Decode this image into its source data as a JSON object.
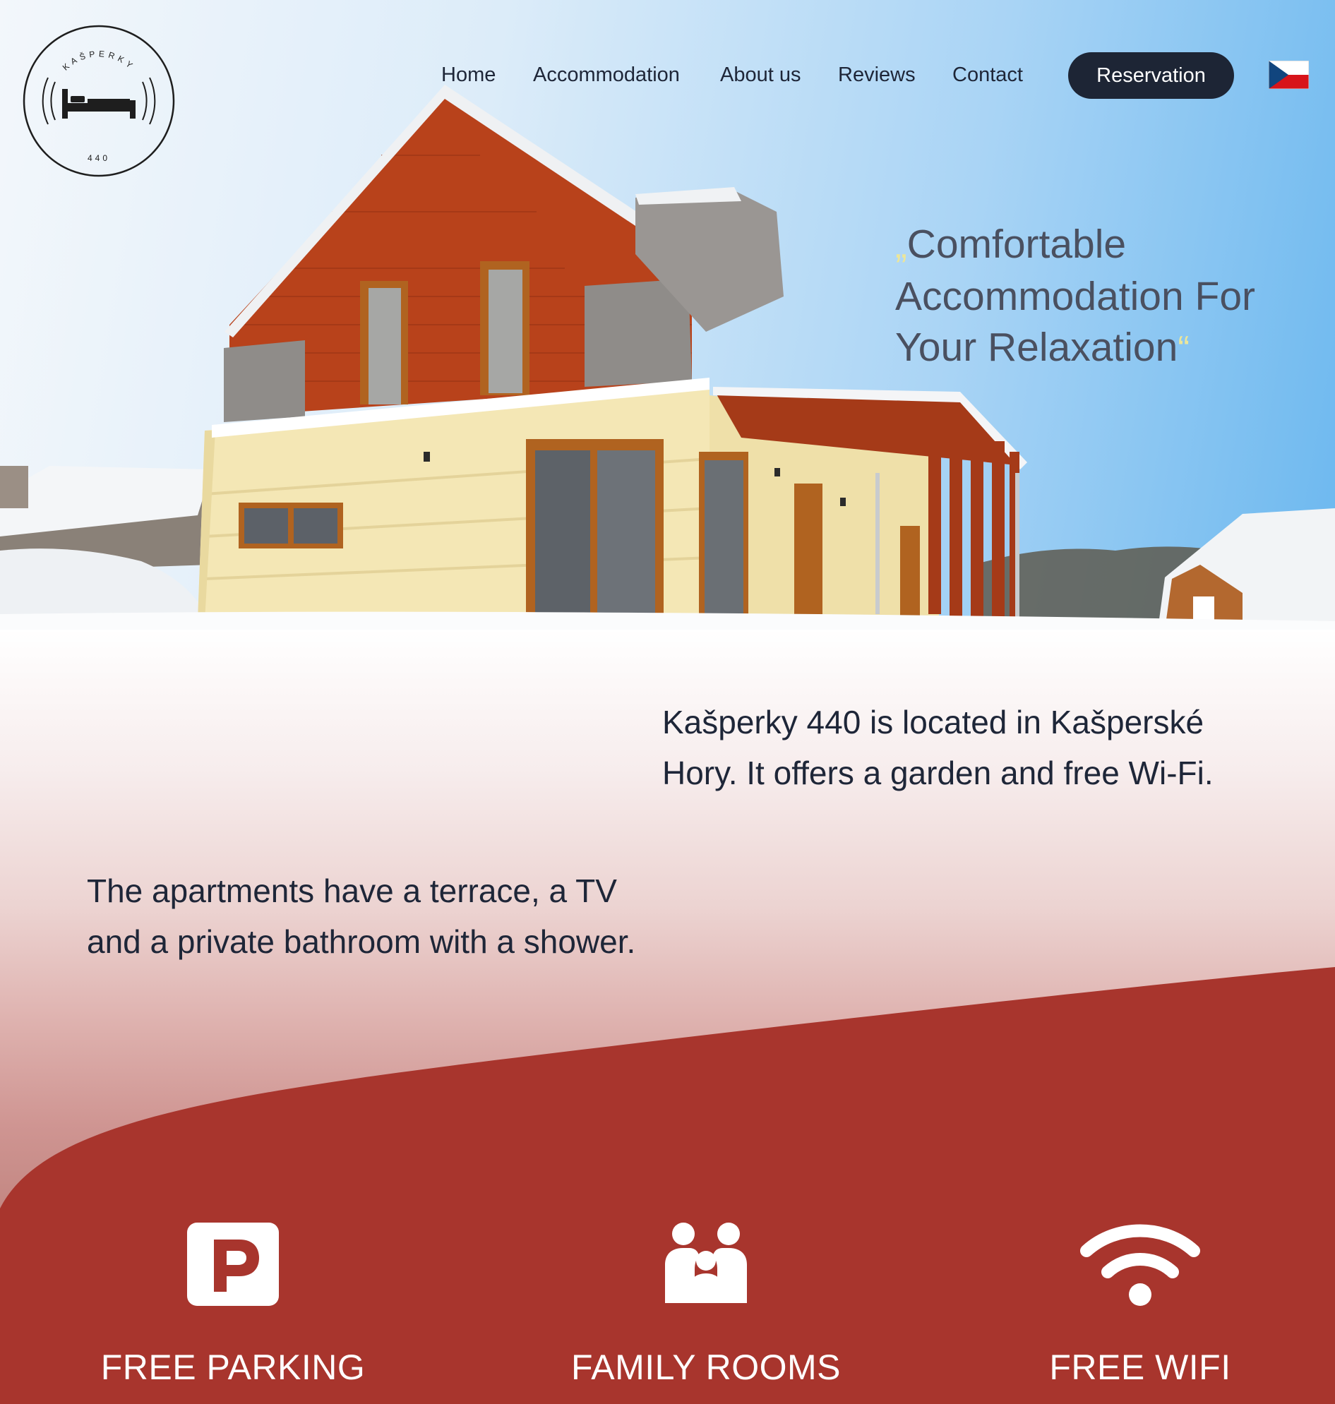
{
  "logo": {
    "top_text": "KAŠPERKY",
    "bottom_text": "440",
    "icon": "bed-icon"
  },
  "nav": {
    "items": [
      {
        "label": "Home"
      },
      {
        "label": "Accommodation"
      },
      {
        "label": "About us"
      },
      {
        "label": "Reviews"
      },
      {
        "label": "Contact"
      }
    ],
    "reservation_label": "Reservation",
    "language_flag": "czech-flag-icon"
  },
  "hero": {
    "quote_open": "„",
    "quote_lines": [
      "Comfortable",
      "Accommodation For",
      "Your Relaxation"
    ],
    "quote_close": "“"
  },
  "intro": {
    "text_1_lines": [
      "Kašperky 440 is located in Kašperské",
      "Hory. It offers a garden and free Wi-Fi."
    ],
    "text_2_lines": [
      "The apartments have a terrace, a TV",
      "and a private bathroom with a shower."
    ]
  },
  "features": [
    {
      "icon": "parking-icon",
      "label": "FREE PARKING"
    },
    {
      "icon": "family-icon",
      "label": "FAMILY ROOMS"
    },
    {
      "icon": "wifi-icon",
      "label": "FREE WIFI"
    }
  ],
  "colors": {
    "accent_red": "#a8352d",
    "nav_dark": "#1d2535",
    "quote_mark_yellow": "#ece69a",
    "text_dark": "#1e2638"
  }
}
